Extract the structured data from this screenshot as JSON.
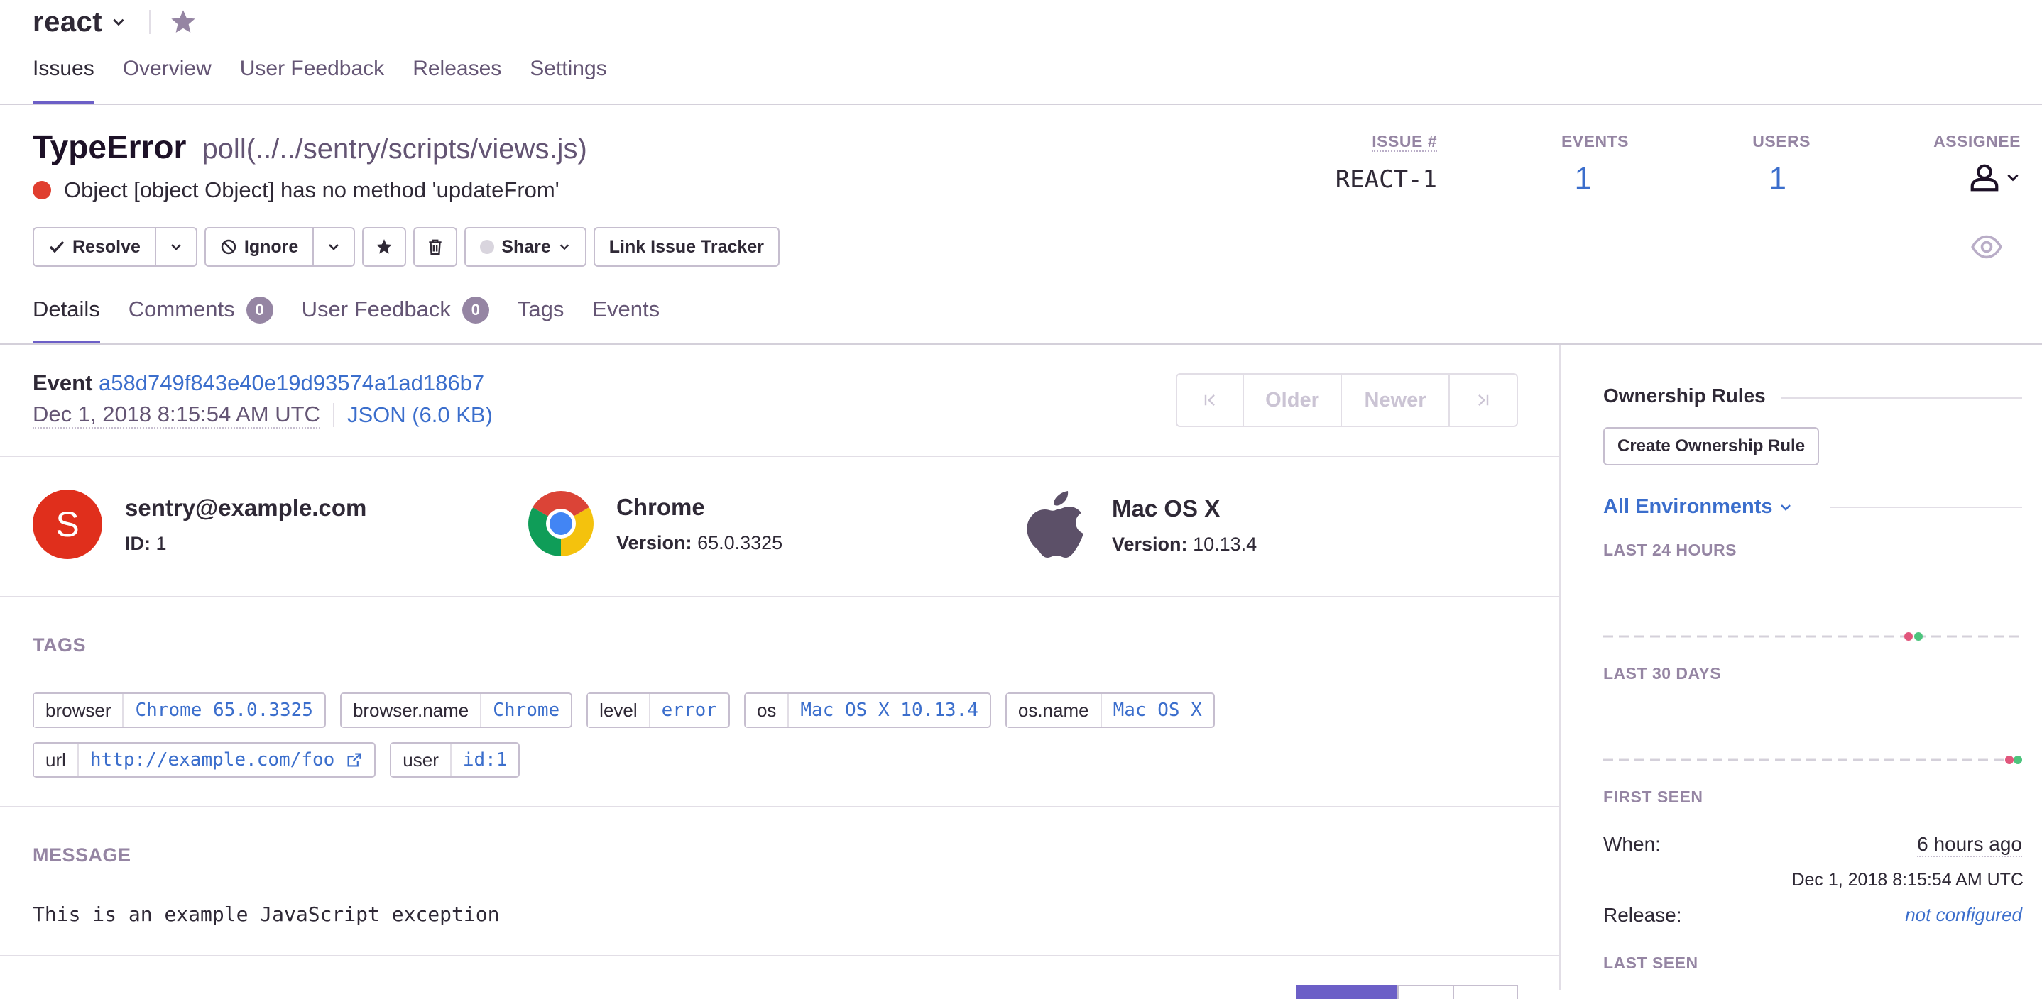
{
  "project": {
    "name": "react"
  },
  "nav": {
    "items": [
      {
        "label": "Issues",
        "active": true
      },
      {
        "label": "Overview"
      },
      {
        "label": "User Feedback"
      },
      {
        "label": "Releases"
      },
      {
        "label": "Settings"
      }
    ]
  },
  "issue": {
    "type": "TypeError",
    "location": "poll(../../sentry/scripts/views.js)",
    "message": "Object [object Object] has no method 'updateFrom'"
  },
  "stats": {
    "issue_label": "ISSUE #",
    "issue_value": "REACT-1",
    "events_label": "EVENTS",
    "events_value": "1",
    "users_label": "USERS",
    "users_value": "1",
    "assignee_label": "ASSIGNEE"
  },
  "actions": {
    "resolve": "Resolve",
    "ignore": "Ignore",
    "share": "Share",
    "link_tracker": "Link Issue Tracker"
  },
  "tabs": [
    {
      "label": "Details",
      "active": true
    },
    {
      "label": "Comments",
      "badge": "0"
    },
    {
      "label": "User Feedback",
      "badge": "0"
    },
    {
      "label": "Tags"
    },
    {
      "label": "Events"
    }
  ],
  "event": {
    "label": "Event",
    "id": "a58d749f843e40e19d93574a1ad186b7",
    "date": "Dec 1, 2018 8:15:54 AM UTC",
    "json": "JSON (6.0 KB)"
  },
  "pager": {
    "older": "Older",
    "newer": "Newer"
  },
  "contexts": {
    "user": {
      "initial": "S",
      "title": "sentry@example.com",
      "sub_label": "ID:",
      "sub_value": "1"
    },
    "browser": {
      "title": "Chrome",
      "sub_label": "Version:",
      "sub_value": "65.0.3325"
    },
    "os": {
      "title": "Mac OS X",
      "sub_label": "Version:",
      "sub_value": "10.13.4"
    }
  },
  "tags_section": {
    "title": "TAGS",
    "tags": [
      {
        "key": "browser",
        "value": "Chrome 65.0.3325"
      },
      {
        "key": "browser.name",
        "value": "Chrome"
      },
      {
        "key": "level",
        "value": "error"
      },
      {
        "key": "os",
        "value": "Mac OS X 10.13.4"
      },
      {
        "key": "os.name",
        "value": "Mac OS X"
      },
      {
        "key": "url",
        "value": "http://example.com/foo",
        "external": true
      },
      {
        "key": "user",
        "value": "id:1"
      }
    ]
  },
  "message_section": {
    "title": "MESSAGE",
    "text": "This is an example JavaScript exception"
  },
  "sidebar": {
    "ownership_title": "Ownership Rules",
    "create_rule": "Create Ownership Rule",
    "environments": "All Environments",
    "last24": "LAST 24 HOURS",
    "last30": "LAST 30 DAYS",
    "first_seen": "FIRST SEEN",
    "when_label": "When:",
    "when_value": "6 hours ago",
    "when_date": "Dec 1, 2018 8:15:54 AM UTC",
    "release_label": "Release:",
    "release_value": "not configured",
    "last_seen": "LAST SEEN"
  },
  "colors": {
    "accent": "#6c5fc7",
    "link": "#3b6ecc",
    "error": "#e03e2f",
    "spark_pink": "#e1567c",
    "spark_green": "#4dc47d"
  }
}
